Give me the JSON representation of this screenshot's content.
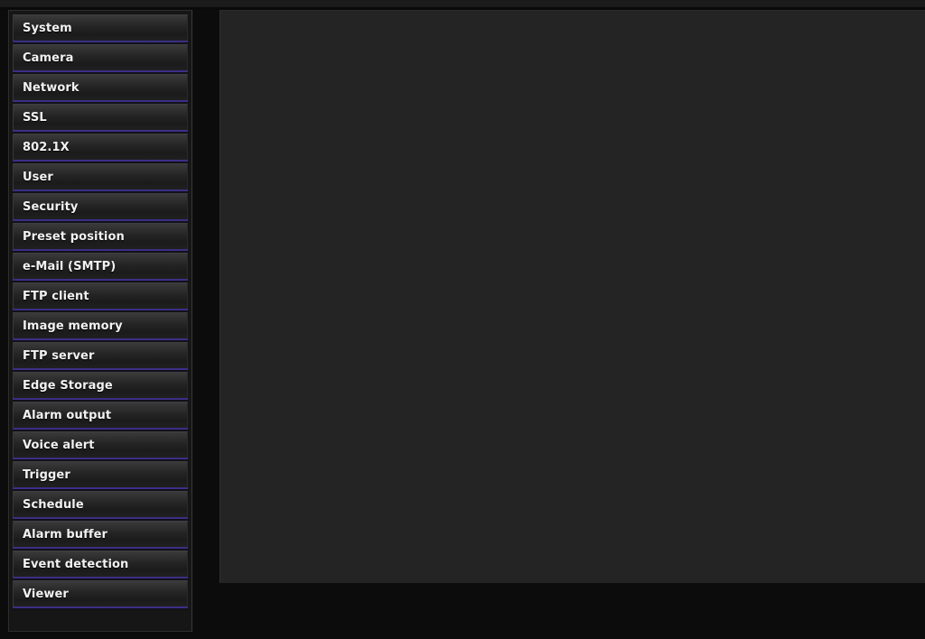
{
  "page": {
    "background_color": "#0c0c0c",
    "content_panel_color": "#242424",
    "separator_color": "#3b2f86",
    "text_color": "#f2f2f2"
  },
  "sidebar": {
    "name": "setup-menu",
    "items": [
      {
        "label": "System"
      },
      {
        "label": "Camera"
      },
      {
        "label": "Network"
      },
      {
        "label": "SSL"
      },
      {
        "label": "802.1X"
      },
      {
        "label": "User"
      },
      {
        "label": "Security"
      },
      {
        "label": "Preset position"
      },
      {
        "label": "e-Mail (SMTP)"
      },
      {
        "label": "FTP client"
      },
      {
        "label": "Image memory"
      },
      {
        "label": "FTP server"
      },
      {
        "label": "Edge Storage"
      },
      {
        "label": "Alarm output"
      },
      {
        "label": "Voice alert"
      },
      {
        "label": "Trigger"
      },
      {
        "label": "Schedule"
      },
      {
        "label": "Alarm buffer"
      },
      {
        "label": "Event detection"
      },
      {
        "label": "Viewer"
      }
    ]
  },
  "main": {
    "content": ""
  }
}
